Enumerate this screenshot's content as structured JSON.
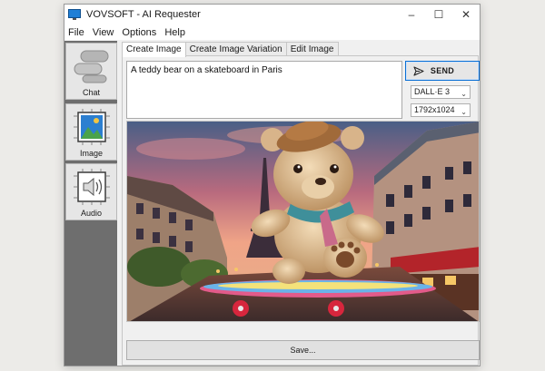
{
  "window": {
    "title": "VOVSOFT - AI Requester",
    "controls": [
      "–",
      "☐",
      "✕"
    ]
  },
  "menu": [
    "File",
    "View",
    "Options",
    "Help"
  ],
  "sidebar": {
    "items": [
      {
        "label": "Chat",
        "icon": "chat-icon"
      },
      {
        "label": "Image",
        "icon": "image-icon"
      },
      {
        "label": "Audio",
        "icon": "audio-icon"
      }
    ]
  },
  "tabs": [
    {
      "label": "Create Image",
      "active": true
    },
    {
      "label": "Create Image Variation",
      "active": false
    },
    {
      "label": "Edit Image",
      "active": false
    }
  ],
  "prompt": {
    "value": "A teddy bear on a skateboard in Paris"
  },
  "send": {
    "label": "SEND",
    "icon": "send-arrow-icon"
  },
  "model_select": {
    "value": "DALL·E 3"
  },
  "size_select": {
    "value": "1792x1024"
  },
  "save": {
    "label": "Save..."
  },
  "colors": {
    "accent": "#0a6fd4",
    "sidebar_bg": "#6e6e6e",
    "window_bg": "#f0f0f0"
  }
}
